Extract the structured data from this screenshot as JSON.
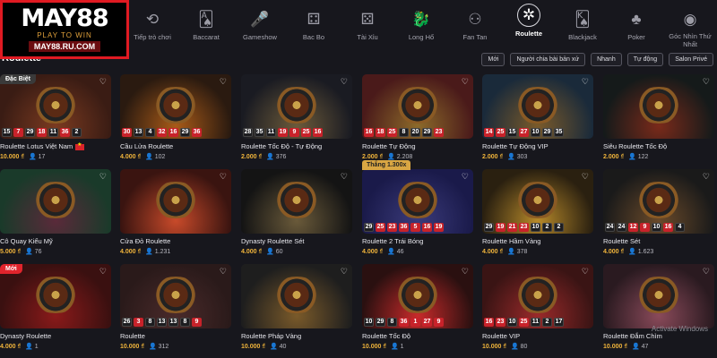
{
  "logo": {
    "brand": "MAY88",
    "tagline": "PLAY TO WIN",
    "site": "MAY88.RU.COM"
  },
  "nav": [
    {
      "label": "Tiếp trò chơi",
      "icon": "history-icon",
      "glyph": "⟲"
    },
    {
      "label": "Baccarat",
      "icon": "baccarat-icon",
      "glyph": "🂡"
    },
    {
      "label": "Gameshow",
      "icon": "gameshow-icon",
      "glyph": "🎤"
    },
    {
      "label": "Bac Bo",
      "icon": "dice-icon",
      "glyph": "⚃"
    },
    {
      "label": "Tài Xỉu",
      "icon": "sicbo-icon",
      "glyph": "⚄"
    },
    {
      "label": "Long Hổ",
      "icon": "dragon-tiger-icon",
      "glyph": "🐉"
    },
    {
      "label": "Fan Tan",
      "icon": "fan-tan-icon",
      "glyph": "⚇"
    },
    {
      "label": "Roulette",
      "icon": "roulette-icon",
      "glyph": "✲",
      "active": true
    },
    {
      "label": "Blackjack",
      "icon": "blackjack-icon",
      "glyph": "🂮"
    },
    {
      "label": "Poker",
      "icon": "poker-icon",
      "glyph": "♣"
    },
    {
      "label": "Góc Nhìn Thứ Nhất",
      "icon": "first-person-icon",
      "glyph": "◉"
    }
  ],
  "section_title": "Roulette",
  "filters": [
    "Mới",
    "Người chia bài bản xứ",
    "Nhanh",
    "Tự động",
    "Salon Privé"
  ],
  "games": [
    {
      "name": "Roulette Lotus Việt Nam",
      "flag": true,
      "price": "10.000 ₫",
      "players": "17",
      "badge": "Đặc Biệt",
      "badge_style": "gold",
      "bg": "#3a1c14",
      "accent": "#7a3a20",
      "nums": [
        [
          "15",
          "b"
        ],
        [
          "7",
          "r"
        ],
        [
          "29",
          "b"
        ],
        [
          "18",
          "r"
        ],
        [
          "11",
          "b"
        ],
        [
          "36",
          "r"
        ],
        [
          "2",
          "b"
        ]
      ]
    },
    {
      "name": "Cầu Lửa Roulette",
      "price": "4.000 ₫",
      "players": "102",
      "bg": "#2a1a10",
      "accent": "#a85a18",
      "nums": [
        [
          "30",
          "r"
        ],
        [
          "13",
          "b"
        ],
        [
          "4",
          "b"
        ],
        [
          "32",
          "r"
        ],
        [
          "16",
          "r"
        ],
        [
          "29",
          "b"
        ],
        [
          "36",
          "r"
        ]
      ]
    },
    {
      "name": "Roulette Tốc Độ - Tự Động",
      "price": "2.000 ₫",
      "players": "376",
      "bg": "#1a1b22",
      "accent": "#6b5a3a",
      "nums": [
        [
          "28",
          "b"
        ],
        [
          "35",
          "b"
        ],
        [
          "11",
          "b"
        ],
        [
          "19",
          "r"
        ],
        [
          "9",
          "r"
        ],
        [
          "25",
          "r"
        ],
        [
          "16",
          "r"
        ]
      ]
    },
    {
      "name": "Roulette Tự Động",
      "price": "2.000 ₫",
      "players": "2.208",
      "bg": "#4a1a1a",
      "accent": "#8c6a2a",
      "nums": [
        [
          "16",
          "r"
        ],
        [
          "18",
          "r"
        ],
        [
          "25",
          "r"
        ],
        [
          "8",
          "b"
        ],
        [
          "20",
          "b"
        ],
        [
          "29",
          "b"
        ],
        [
          "23",
          "r"
        ]
      ]
    },
    {
      "name": "Roulette Tự Động VIP",
      "price": "2.000 ₫",
      "players": "303",
      "bg": "#1a2a3a",
      "accent": "#7a5a2a",
      "nums": [
        [
          "14",
          "r"
        ],
        [
          "25",
          "r"
        ],
        [
          "15",
          "b"
        ],
        [
          "27",
          "r"
        ],
        [
          "10",
          "b"
        ],
        [
          "29",
          "b"
        ],
        [
          "35",
          "b"
        ]
      ]
    },
    {
      "name": "Siêu Roulette Tốc Độ",
      "price": "2.000 ₫",
      "players": "122",
      "bg": "#151a1a",
      "accent": "#7a2a1a",
      "nums": []
    },
    {
      "name": "Cô Quay Kiểu Mỹ",
      "price": "5.000 ₫",
      "players": "76",
      "bg": "#1a3a2a",
      "accent": "#5a2a3a",
      "nums": []
    },
    {
      "name": "Cửa Đỏ Roulette",
      "price": "4.000 ₫",
      "players": "1.231",
      "bg": "#3a1410",
      "accent": "#c84a2a",
      "nums": []
    },
    {
      "name": "Dynasty Roulette Sét",
      "price": "4.000 ₫",
      "players": "60",
      "bg": "#141414",
      "accent": "#6a5a3a",
      "nums": []
    },
    {
      "name": "Roulette 2 Trái Bóng",
      "price": "4.000 ₫",
      "players": "46",
      "top_badge": "Thắng 1.300x",
      "bg": "#1a1a4a",
      "accent": "#3a3a7a",
      "nums": [
        [
          "29",
          "b"
        ],
        [
          "25",
          "r"
        ],
        [
          "23",
          "r"
        ],
        [
          "36",
          "r"
        ],
        [
          "5",
          "r"
        ],
        [
          "16",
          "r"
        ],
        [
          "19",
          "r"
        ]
      ]
    },
    {
      "name": "Roulette Hầm Vàng",
      "price": "4.000 ₫",
      "players": "378",
      "bg": "#2a2010",
      "accent": "#b88a2a",
      "nums": [
        [
          "29",
          "b"
        ],
        [
          "19",
          "r"
        ],
        [
          "21",
          "r"
        ],
        [
          "23",
          "r"
        ],
        [
          "10",
          "b"
        ],
        [
          "2",
          "b"
        ],
        [
          "2",
          "b"
        ]
      ]
    },
    {
      "name": "Roulette Sét",
      "price": "4.000 ₫",
      "players": "1.623",
      "bg": "#1a1a1a",
      "accent": "#6a4a2a",
      "nums": [
        [
          "24",
          "b"
        ],
        [
          "24",
          "b"
        ],
        [
          "12",
          "r"
        ],
        [
          "9",
          "r"
        ],
        [
          "10",
          "b"
        ],
        [
          "16",
          "r"
        ],
        [
          "4",
          "b"
        ]
      ]
    },
    {
      "name": "Dynasty Roulette",
      "price": "4.000 ₫",
      "players": "1",
      "badge": "Mới",
      "badge_style": "red",
      "bg": "#3a1010",
      "accent": "#8a1a1a",
      "nums": []
    },
    {
      "name": "Roulette",
      "price": "10.000 ₫",
      "players": "312",
      "bg": "#2a1a1a",
      "accent": "#4a2a2a",
      "nums": [
        [
          "26",
          "b"
        ],
        [
          "3",
          "r"
        ],
        [
          "8",
          "b"
        ],
        [
          "13",
          "b"
        ],
        [
          "13",
          "b"
        ],
        [
          "8",
          "b"
        ],
        [
          "9",
          "r"
        ]
      ]
    },
    {
      "name": "Roulette Pháp Vàng",
      "price": "10.000 ₫",
      "players": "40",
      "bg": "#1e1e1e",
      "accent": "#7a5a2a",
      "nums": []
    },
    {
      "name": "Roulette Tốc Độ",
      "price": "10.000 ₫",
      "players": "1",
      "bg": "#2a1010",
      "accent": "#c82a2a",
      "nums": [
        [
          "10",
          "b"
        ],
        [
          "29",
          "b"
        ],
        [
          "8",
          "b"
        ],
        [
          "36",
          "r"
        ],
        [
          "1",
          "r"
        ],
        [
          "27",
          "r"
        ],
        [
          "9",
          "r"
        ]
      ]
    },
    {
      "name": "Roulette VIP",
      "price": "10.000 ₫",
      "players": "80",
      "bg": "#3a1414",
      "accent": "#9a2a2a",
      "nums": [
        [
          "16",
          "r"
        ],
        [
          "23",
          "r"
        ],
        [
          "10",
          "b"
        ],
        [
          "25",
          "r"
        ],
        [
          "11",
          "b"
        ],
        [
          "2",
          "b"
        ],
        [
          "17",
          "b"
        ]
      ]
    },
    {
      "name": "Roulette Đắm Chìm",
      "price": "10.000 ₫",
      "players": "47",
      "bg": "#2a1a20",
      "accent": "#8a4a5a",
      "nums": []
    }
  ],
  "watermark": "Activate Windows"
}
